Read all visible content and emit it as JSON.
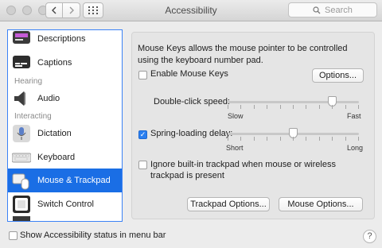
{
  "window": {
    "title": "Accessibility"
  },
  "search": {
    "placeholder": "Search"
  },
  "sidebar": {
    "items": [
      {
        "label": "Descriptions"
      },
      {
        "label": "Captions"
      },
      {
        "label": "Audio"
      },
      {
        "label": "Dictation"
      },
      {
        "label": "Keyboard"
      },
      {
        "label": "Mouse & Trackpad"
      },
      {
        "label": "Switch Control"
      }
    ],
    "sections": {
      "hearing": "Hearing",
      "interacting": "Interacting"
    }
  },
  "main": {
    "description": "Mouse Keys allows the mouse pointer to be controlled using the keyboard number pad.",
    "enable_mouse_keys": "Enable Mouse Keys",
    "options_button": "Options...",
    "double_click": {
      "label": "Double-click speed:",
      "min_label": "Slow",
      "max_label": "Fast",
      "value": 0.8
    },
    "spring_loading": {
      "label": "Spring-loading delay:",
      "min_label": "Short",
      "max_label": "Long",
      "value": 0.5
    },
    "ignore_trackpad": "Ignore built-in trackpad when mouse or wireless trackpad is present",
    "trackpad_options": "Trackpad Options...",
    "mouse_options": "Mouse Options..."
  },
  "footer": {
    "show_status": "Show Accessibility status in menu bar",
    "help": "?"
  }
}
